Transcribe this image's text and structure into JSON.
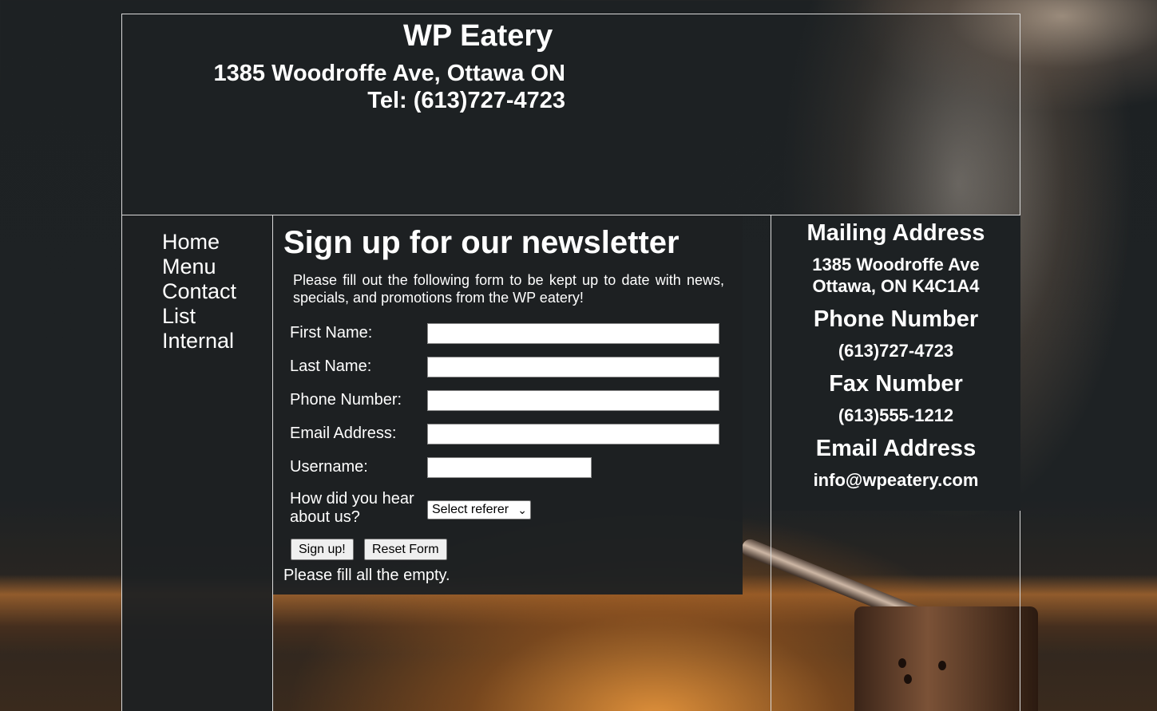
{
  "header": {
    "title": "WP Eatery",
    "address": "1385 Woodroffe Ave, Ottawa ON",
    "phone": "Tel: (613)727-4723"
  },
  "nav": {
    "items": [
      {
        "label": "Home"
      },
      {
        "label": "Menu"
      },
      {
        "label": "Contact"
      },
      {
        "label": "List"
      },
      {
        "label": "Internal"
      }
    ]
  },
  "main": {
    "heading": "Sign up for our newsletter",
    "intro": "Please fill out the following form to be kept up to date with news, specials, and promotions from the WP eatery!",
    "form": {
      "first_name_label": "First Name:",
      "first_name_value": "",
      "last_name_label": "Last Name:",
      "last_name_value": "",
      "phone_label": "Phone Number:",
      "phone_value": "",
      "email_label": "Email Address:",
      "email_value": "",
      "username_label": "Username:",
      "username_value": "",
      "referer_label": "How did you hear about us?",
      "referer_selected": "Select referer",
      "submit_label": "Sign up!",
      "reset_label": "Reset Form"
    },
    "message": "Please fill all the empty."
  },
  "sidebar": {
    "mailing_heading": "Mailing Address",
    "mailing_line1": "1385 Woodroffe Ave",
    "mailing_line2": "Ottawa, ON K4C1A4",
    "phone_heading": "Phone Number",
    "phone_value": "(613)727-4723",
    "fax_heading": "Fax Number",
    "fax_value": "(613)555-1212",
    "email_heading": "Email Address",
    "email_value": "info@wpeatery.com"
  }
}
